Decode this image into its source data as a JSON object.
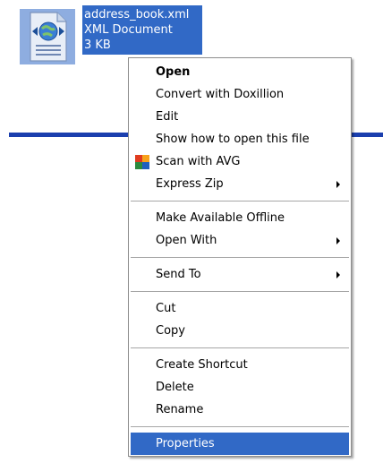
{
  "file": {
    "name": "address_book.xml",
    "type": "XML Document",
    "size": "3 KB",
    "icon": "xml-document-icon"
  },
  "context_menu": {
    "groups": [
      [
        {
          "label": "Open",
          "bold": true
        },
        {
          "label": "Convert with Doxillion"
        },
        {
          "label": "Edit"
        },
        {
          "label": "Show how to open this file"
        },
        {
          "label": "Scan with AVG",
          "icon": "avg-icon"
        },
        {
          "label": "Express Zip",
          "submenu": true
        }
      ],
      [
        {
          "label": "Make Available Offline"
        },
        {
          "label": "Open With",
          "submenu": true
        }
      ],
      [
        {
          "label": "Send To",
          "submenu": true
        }
      ],
      [
        {
          "label": "Cut"
        },
        {
          "label": "Copy"
        }
      ],
      [
        {
          "label": "Create Shortcut"
        },
        {
          "label": "Delete"
        },
        {
          "label": "Rename"
        }
      ],
      [
        {
          "label": "Properties",
          "selected": true
        }
      ]
    ]
  },
  "colors": {
    "selection": "#3169c6",
    "background_line": "#1b3fae"
  }
}
